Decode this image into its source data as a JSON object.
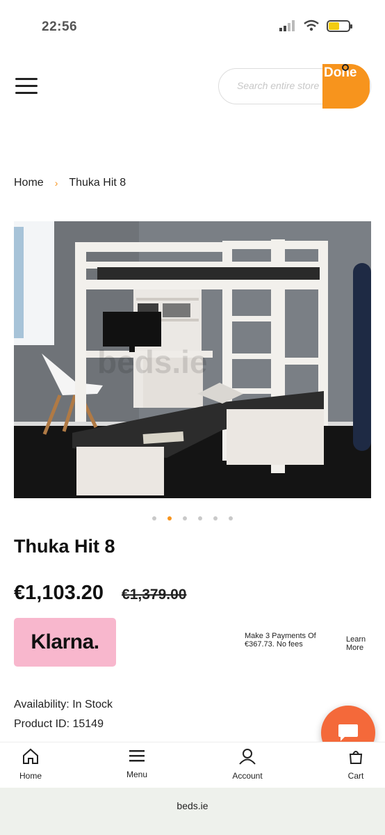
{
  "status_bar": {
    "time": "22:56"
  },
  "header": {
    "search_placeholder": "Search entire store",
    "done_label": "Done"
  },
  "breadcrumb": {
    "home": "Home",
    "separator": "›",
    "current": "Thuka Hit 8"
  },
  "gallery": {
    "watermark": "beds.ie",
    "dot_count": 6,
    "active_dot": 1
  },
  "product": {
    "title": "Thuka Hit 8",
    "price": "€1,103.20",
    "old_price": "€1,379.00",
    "availability": "Availability: In Stock",
    "product_id": "Product ID: 15149"
  },
  "klarna": {
    "logo": "Klarna.",
    "text": "Make 3 Payments Of €367.73. No fees",
    "learn_more": "Learn More"
  },
  "bottom_nav": {
    "home": "Home",
    "menu": "Menu",
    "account": "Account",
    "cart": "Cart"
  },
  "url_bar": {
    "url": "beds.ie"
  },
  "colors": {
    "accent": "#f7941d",
    "klarna_pink": "#f8b7cd",
    "chat": "#f4693a"
  }
}
